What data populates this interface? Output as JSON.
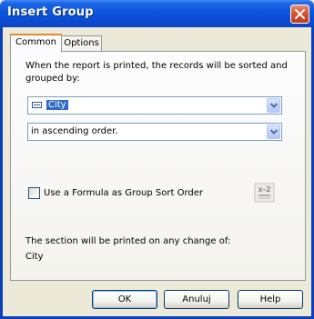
{
  "window": {
    "title": "Insert Group"
  },
  "tabs": [
    {
      "label": "Common"
    },
    {
      "label": "Options"
    }
  ],
  "common": {
    "description_line1": "When the report is printed, the records will be sorted and",
    "description_line2": "grouped by:",
    "group_field": {
      "value": "City",
      "icon": "database-field-icon"
    },
    "sort_order": {
      "value": "in ascending order."
    },
    "use_formula": {
      "label": "Use a Formula as Group Sort Order",
      "checked": false
    },
    "formula_button": {
      "icon": "formula-x2-icon",
      "glyph": "x-2"
    },
    "section_note": "The section will be printed on any change of:",
    "section_field": "City"
  },
  "buttons": {
    "ok": "OK",
    "cancel": "Anuluj",
    "help": "Help"
  },
  "colors": {
    "titlebar": "#0b55dc",
    "selection": "#316ac5",
    "active_tab_accent": "#e68b2c",
    "dialog_bg": "#ece9d8"
  }
}
